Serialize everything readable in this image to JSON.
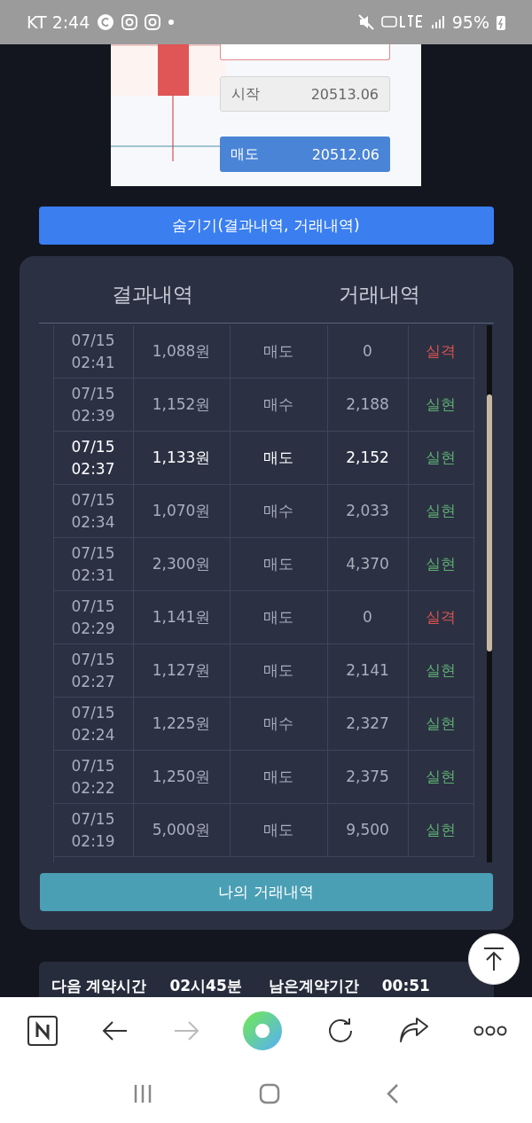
{
  "status_bar": {
    "carrier_time": "KT 2:44",
    "battery": "95%"
  },
  "chart": {
    "start_label": "시작",
    "start_value": "20513.06",
    "sell_label": "매도",
    "sell_value": "20512.06"
  },
  "hide_button": "숨기기(결과내역, 거래내역)",
  "tabs": [
    {
      "label": "결과내역",
      "selected": false
    },
    {
      "label": "거래내역",
      "selected": false
    }
  ],
  "rows": [
    {
      "date": "07/15",
      "time": "02:41",
      "amount": "1,088원",
      "side": "매도",
      "payout": "0",
      "result": "실격",
      "kind": "fail",
      "selected": false
    },
    {
      "date": "07/15",
      "time": "02:39",
      "amount": "1,152원",
      "side": "매수",
      "payout": "2,188",
      "result": "실현",
      "kind": "win",
      "selected": false
    },
    {
      "date": "07/15",
      "time": "02:37",
      "amount": "1,133원",
      "side": "매도",
      "payout": "2,152",
      "result": "실현",
      "kind": "win",
      "selected": true
    },
    {
      "date": "07/15",
      "time": "02:34",
      "amount": "1,070원",
      "side": "매수",
      "payout": "2,033",
      "result": "실현",
      "kind": "win",
      "selected": false
    },
    {
      "date": "07/15",
      "time": "02:31",
      "amount": "2,300원",
      "side": "매도",
      "payout": "4,370",
      "result": "실현",
      "kind": "win",
      "selected": false
    },
    {
      "date": "07/15",
      "time": "02:29",
      "amount": "1,141원",
      "side": "매도",
      "payout": "0",
      "result": "실격",
      "kind": "fail",
      "selected": false
    },
    {
      "date": "07/15",
      "time": "02:27",
      "amount": "1,127원",
      "side": "매도",
      "payout": "2,141",
      "result": "실현",
      "kind": "win",
      "selected": false
    },
    {
      "date": "07/15",
      "time": "02:24",
      "amount": "1,225원",
      "side": "매수",
      "payout": "2,327",
      "result": "실현",
      "kind": "win",
      "selected": false
    },
    {
      "date": "07/15",
      "time": "02:22",
      "amount": "1,250원",
      "side": "매도",
      "payout": "2,375",
      "result": "실현",
      "kind": "win",
      "selected": false
    },
    {
      "date": "07/15",
      "time": "02:19",
      "amount": "5,000원",
      "side": "매도",
      "payout": "9,500",
      "result": "실현",
      "kind": "win",
      "selected": false
    }
  ],
  "history_button": "나의 거래내역",
  "info": [
    {
      "label": "다음 계약시간",
      "value": "02시45분"
    },
    {
      "label": "남은계약기간",
      "value": "00:51"
    }
  ]
}
